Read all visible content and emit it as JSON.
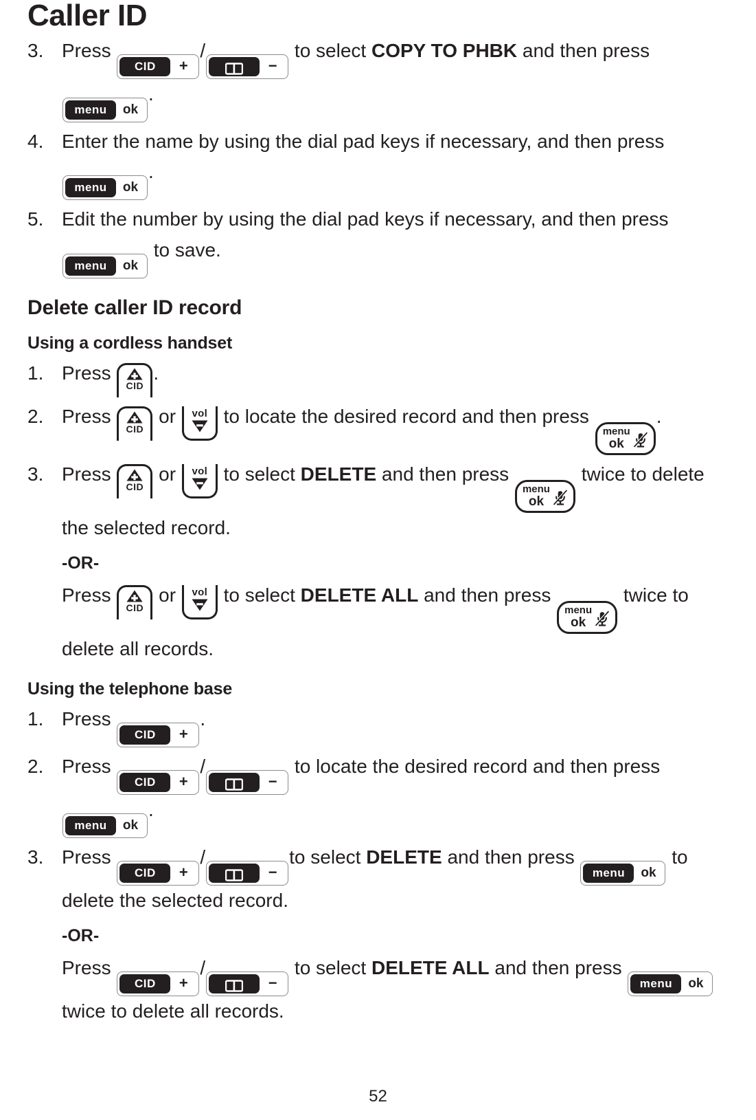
{
  "document": {
    "chapter_title": "Caller ID",
    "page_number": "52"
  },
  "icons": {
    "cid_base_label": "CID",
    "plus_sign": "+",
    "minus_sign": "−",
    "menu_label": "menu",
    "ok_label": "ok",
    "vol_label": "vol",
    "cid_handset_label": "CID",
    "phonebook_icon": "open-book-icon",
    "mute_icon": "muted-microphone-icon"
  },
  "colors": {
    "text": "#231f20",
    "key_fill": "#231f20",
    "key_outline": "#8b8b8b",
    "page_background": "#ffffff"
  },
  "copy_to_phbk_steps": [
    {
      "marker": "3.",
      "t1": "Press ",
      "sep": "/",
      "t2": " to select ",
      "emphasis": "COPY TO PHBK",
      "t3": " and then press ",
      "t4": "."
    },
    {
      "marker": "4.",
      "t1": "Enter the name by using the dial pad keys if necessary, and then press ",
      "t2": "."
    },
    {
      "marker": "5.",
      "t1": "Edit the number by using the dial pad keys if necessary, and then press ",
      "t2": " to save."
    }
  ],
  "delete_section": {
    "heading": "Delete caller ID record",
    "handset": {
      "sub_heading": "Using a cordless handset",
      "steps": [
        {
          "marker": "1.",
          "t1": "Press ",
          "t2": "."
        },
        {
          "marker": "2.",
          "t1": "Press ",
          "t2": " or ",
          "t3": " to locate the desired record and then press ",
          "t4": "."
        },
        {
          "marker": "3.",
          "t1": "Press ",
          "t2": " or ",
          "t3": " to select ",
          "emphasis": "DELETE",
          "t4": " and then press ",
          "t5": " twice to delete the selected record."
        }
      ],
      "or_label": "-OR-",
      "or_paragraph": {
        "t1": "Press ",
        "t2": " or ",
        "t3": " to select ",
        "emphasis": "DELETE ALL",
        "t4": " and then press ",
        "t5": " twice to delete all records."
      }
    },
    "base": {
      "sub_heading": "Using the telephone base",
      "steps": [
        {
          "marker": "1.",
          "t1": "Press ",
          "t2": "."
        },
        {
          "marker": "2.",
          "t1": "Press ",
          "sep": "/",
          "t2": " to locate the desired record and then press ",
          "t3": "."
        },
        {
          "marker": "3.",
          "t1": "Press ",
          "sep": "/",
          "t2": "to select ",
          "emphasis": "DELETE",
          "t3": " and then press ",
          "t4": " to delete the selected record."
        }
      ],
      "or_label": "-OR-",
      "or_paragraph": {
        "t1": "Press ",
        "sep": "/",
        "t2": " to select ",
        "emphasis": "DELETE ALL",
        "t3": " and then press ",
        "t4": " twice to delete all records."
      }
    }
  }
}
